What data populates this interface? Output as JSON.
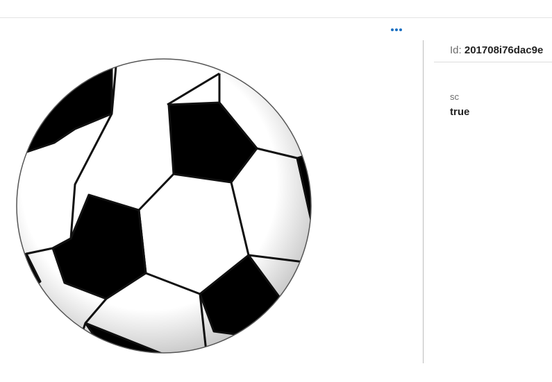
{
  "toolbar": {
    "more_icon": "more-horizontal-icon",
    "accent": "#1a6fc2"
  },
  "image": {
    "subject": "soccer-ball"
  },
  "details": {
    "id_label": "Id:",
    "id_value": "201708i76dac9e",
    "properties": [
      {
        "name": "sc",
        "value": "true"
      }
    ]
  }
}
